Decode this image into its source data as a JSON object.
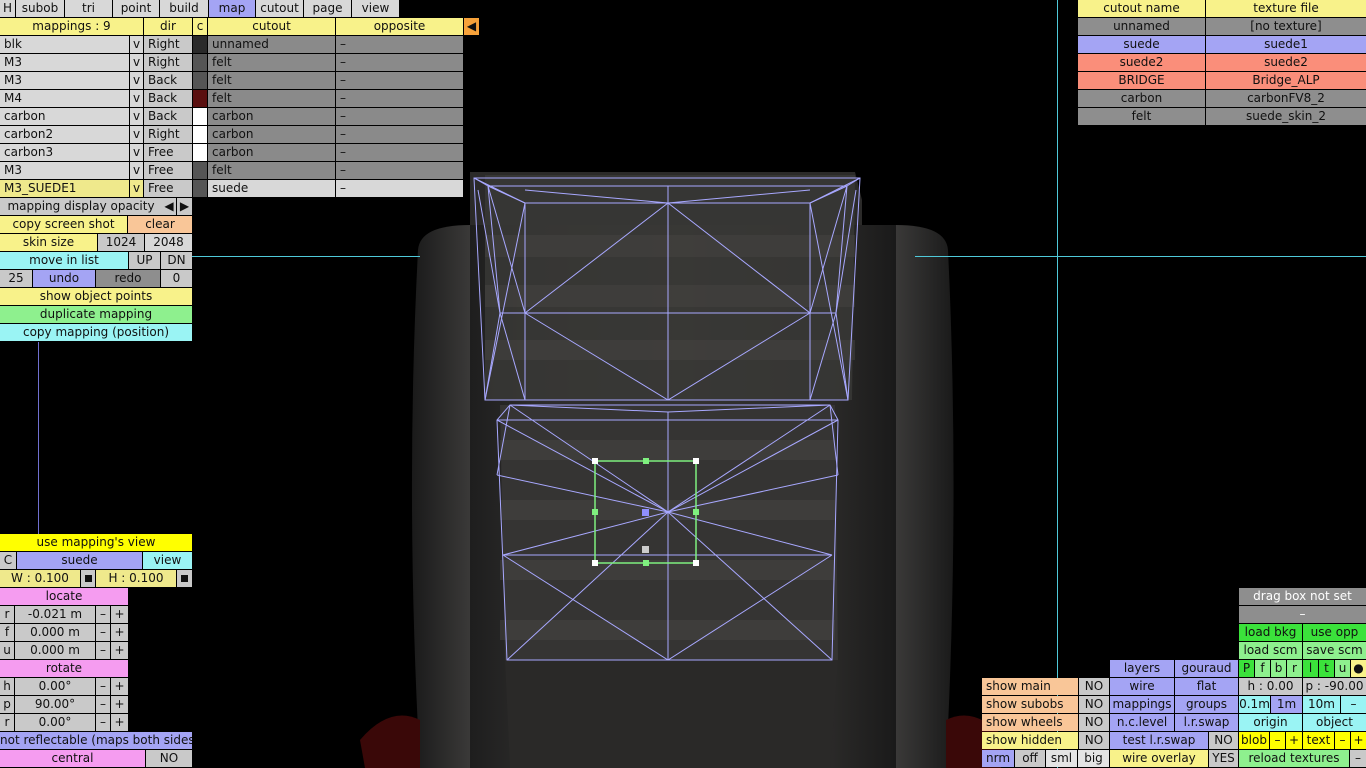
{
  "menu": [
    {
      "label": "H",
      "active": false
    },
    {
      "label": "subob",
      "active": false
    },
    {
      "label": "tri",
      "active": false
    },
    {
      "label": "point",
      "active": false
    },
    {
      "label": "build",
      "active": false
    },
    {
      "label": "map",
      "active": true
    },
    {
      "label": "cutout",
      "active": false
    },
    {
      "label": "page",
      "active": false
    },
    {
      "label": "view",
      "active": false
    }
  ],
  "mappings_table": {
    "headers": {
      "mappings": "mappings : 9",
      "dir": "dir",
      "c": "c",
      "cutout": "cutout",
      "opposite": "opposite"
    },
    "rows": [
      {
        "name": "blk",
        "v": "v",
        "dir": "Right",
        "swatch": "#2a2a2a",
        "cutout": "unnamed",
        "opposite": "–"
      },
      {
        "name": "M3",
        "v": "v",
        "dir": "Right",
        "swatch": "#555555",
        "cutout": "felt",
        "opposite": "–"
      },
      {
        "name": "M3",
        "v": "v",
        "dir": "Back",
        "swatch": "#555555",
        "cutout": "felt",
        "opposite": "–"
      },
      {
        "name": "M4",
        "v": "v",
        "dir": "Back",
        "swatch": "#5a0f0f",
        "cutout": "felt",
        "opposite": "–"
      },
      {
        "name": "carbon",
        "v": "v",
        "dir": "Back",
        "swatch": "#ffffff",
        "cutout": "carbon",
        "opposite": "–"
      },
      {
        "name": "carbon2",
        "v": "v",
        "dir": "Right",
        "swatch": "#ffffff",
        "cutout": "carbon",
        "opposite": "–"
      },
      {
        "name": "carbon3",
        "v": "v",
        "dir": "Free",
        "swatch": "#ffffff",
        "cutout": "carbon",
        "opposite": "–"
      },
      {
        "name": "M3",
        "v": "v",
        "dir": "Free",
        "swatch": "#555555",
        "cutout": "felt",
        "opposite": "–"
      },
      {
        "name": "M3_SUEDE1",
        "v": "v",
        "dir": "Free",
        "swatch": "#555555",
        "cutout": "suede",
        "opposite": "–",
        "selected": true
      }
    ]
  },
  "left_panel": {
    "opacity_label": "mapping display opacity",
    "opacity_left": "◀",
    "opacity_right": "▶",
    "copy_screenshot": "copy screen shot",
    "clear": "clear",
    "skin_size": "skin size",
    "skin_w": "1024",
    "skin_h": "2048",
    "move_in_list": "move in list",
    "up": "UP",
    "dn": "DN",
    "undo_count": "25",
    "undo": "undo",
    "redo": "redo",
    "redo_count": "0",
    "show_object_points": "show object points",
    "duplicate_mapping": "duplicate mapping",
    "copy_mapping": "copy mapping (position)"
  },
  "mapping_view": {
    "use_view": "use mapping's view",
    "c": "C",
    "name": "suede",
    "view": "view",
    "w": "W : 0.100",
    "h": "H : 0.100",
    "locate": "locate",
    "loc_rows": [
      {
        "k": "r",
        "v": "-0.021 m"
      },
      {
        "k": "f",
        "v": "0.000 m"
      },
      {
        "k": "u",
        "v": "0.000 m"
      }
    ],
    "rotate": "rotate",
    "rot_rows": [
      {
        "k": "h",
        "v": "0.00°"
      },
      {
        "k": "p",
        "v": "90.00°"
      },
      {
        "k": "r",
        "v": "0.00°"
      }
    ],
    "minus": "–",
    "plus": "+",
    "reflect": "not reflectable (maps both sides)",
    "central": "central",
    "central_val": "NO"
  },
  "cutout_table": {
    "headers": {
      "name": "cutout name",
      "file": "texture file"
    },
    "rows": [
      {
        "name": "unnamed",
        "file": "[no texture]",
        "color": "#8e8e8e"
      },
      {
        "name": "suede",
        "file": "suede1",
        "color": "#a4a4f4"
      },
      {
        "name": "suede2",
        "file": "suede2",
        "color": "#fa8e7a"
      },
      {
        "name": "BRIDGE",
        "file": "Bridge_ALP",
        "color": "#fa8e7a"
      },
      {
        "name": "carbon",
        "file": "carbonFV8_2",
        "color": "#8e8e8e"
      },
      {
        "name": "felt",
        "file": "suede_skin_2",
        "color": "#8e8e8e"
      }
    ]
  },
  "bottom_right": {
    "drag_box": "drag box not set",
    "dash": "–",
    "load_bkg": "load bkg",
    "use_opp": "use opp",
    "load_scm": "load scm",
    "save_scm": "save scm",
    "flags": [
      "P",
      "f",
      "b",
      "r",
      "l",
      "t",
      "u",
      "●"
    ],
    "layers": "layers",
    "gouraud": "gouraud",
    "wire": "wire",
    "flat": "flat",
    "h_val": "h : 0.00",
    "p_val": "p : -90.00",
    "mappings": "mappings",
    "groups": "groups",
    "d01": "0.1m",
    "d1": "1m",
    "d10": "10m",
    "dminus": "–",
    "nclevel": "n.c.level",
    "lrswap": "l.r.swap",
    "origin": "origin",
    "object": "object",
    "test_lrswap": "test l.r.swap",
    "test_no": "NO",
    "blob": "blob",
    "text": "text",
    "minus": "–",
    "plus": "+",
    "wire_overlay": "wire overlay",
    "wire_yes": "YES",
    "reload": "reload textures",
    "reload_minus": "–",
    "show_main": "show main",
    "show_subobs": "show subobs",
    "show_wheels": "show wheels",
    "show_hidden": "show hidden",
    "no": "NO",
    "nrm": "nrm",
    "off": "off",
    "sml": "sml",
    "big": "big"
  },
  "colors": {
    "wire": "#a8a8ff",
    "crosshair": "#4fc9d9",
    "mapping_box": "#7ff07f",
    "accent_orange": "#f7a23a"
  }
}
